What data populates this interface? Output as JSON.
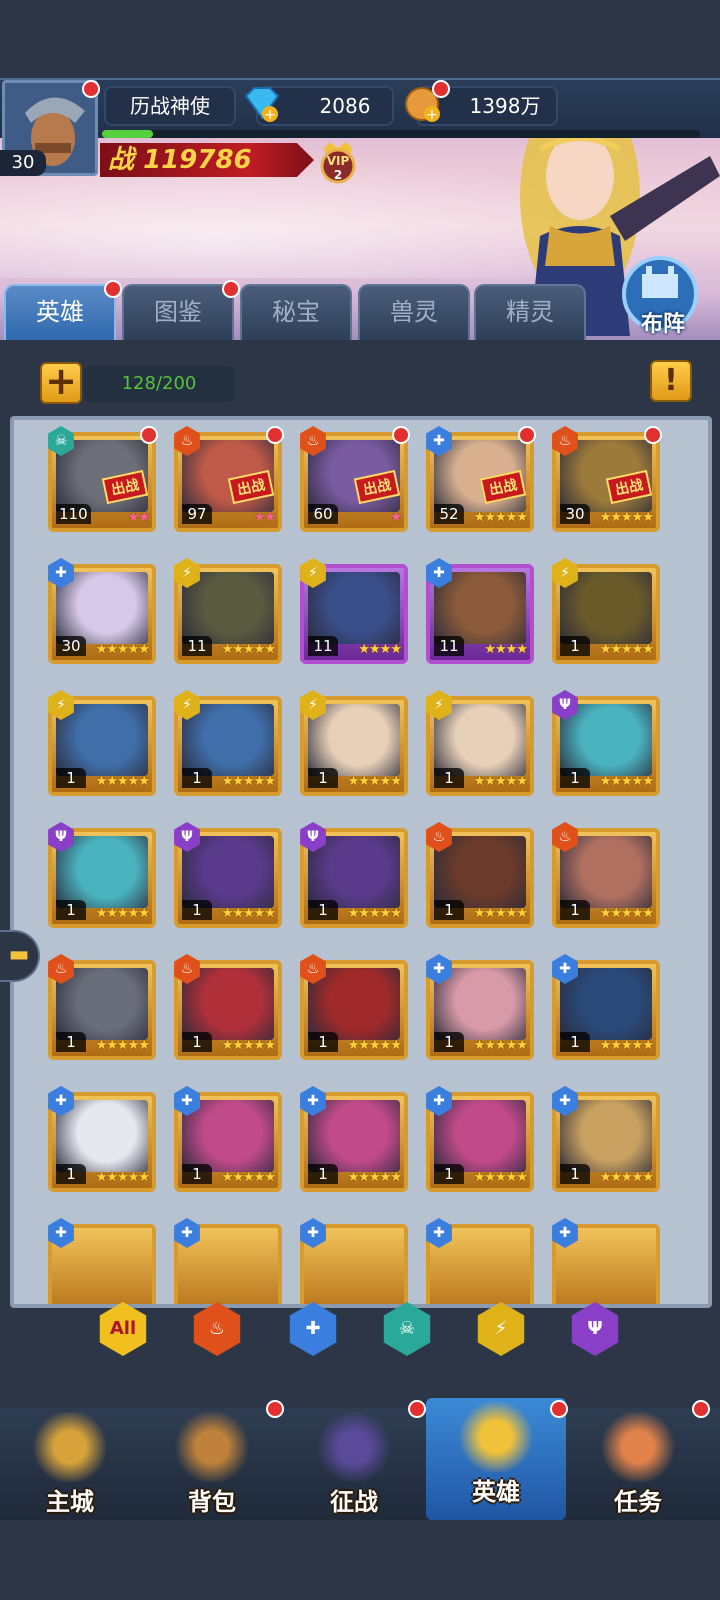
{
  "player": {
    "level": "30",
    "title": "历战神使",
    "diamonds": "2086",
    "gold": "1398万",
    "power_label": "战",
    "power_value": "119786",
    "vip_label": "VIP",
    "vip_level": "2",
    "exp_progress": 0.085
  },
  "tabs": [
    {
      "label": "英雄",
      "active": true,
      "dot": true
    },
    {
      "label": "图鉴",
      "active": false,
      "dot": true
    },
    {
      "label": "秘宝",
      "active": false,
      "dot": false
    },
    {
      "label": "兽灵",
      "active": false,
      "dot": false
    },
    {
      "label": "精灵",
      "active": false,
      "dot": false
    }
  ],
  "formation_label": "布阵",
  "hero_count": "128/200",
  "deploy_badge": "出战",
  "heroes": [
    {
      "level": "110",
      "stars": 2,
      "star_color": "pink",
      "faction": "skull",
      "deployed": true,
      "dot": true
    },
    {
      "level": "97",
      "stars": 2,
      "star_color": "pink",
      "faction": "fire",
      "deployed": true,
      "dot": true
    },
    {
      "level": "60",
      "stars": 1,
      "star_color": "pink",
      "faction": "fire",
      "deployed": true,
      "dot": true
    },
    {
      "level": "52",
      "stars": 5,
      "star_color": "gold",
      "faction": "cross",
      "deployed": true,
      "dot": true
    },
    {
      "level": "30",
      "stars": 5,
      "star_color": "gold",
      "faction": "fire",
      "deployed": true,
      "dot": true
    },
    {
      "level": "30",
      "stars": 5,
      "star_color": "gold",
      "faction": "cross",
      "deployed": false,
      "dot": false
    },
    {
      "level": "11",
      "stars": 5,
      "star_color": "gold",
      "faction": "wing",
      "deployed": false,
      "dot": false
    },
    {
      "level": "11",
      "stars": 4,
      "star_color": "gold",
      "faction": "wing",
      "deployed": false,
      "dot": false,
      "rarity": "purple"
    },
    {
      "level": "11",
      "stars": 4,
      "star_color": "gold",
      "faction": "cross",
      "deployed": false,
      "dot": false,
      "rarity": "purple"
    },
    {
      "level": "1",
      "stars": 5,
      "star_color": "gold",
      "faction": "wing",
      "deployed": false,
      "dot": false
    },
    {
      "level": "1",
      "stars": 5,
      "star_color": "gold",
      "faction": "wing",
      "deployed": false,
      "dot": false
    },
    {
      "level": "1",
      "stars": 5,
      "star_color": "gold",
      "faction": "wing",
      "deployed": false,
      "dot": false
    },
    {
      "level": "1",
      "stars": 5,
      "star_color": "gold",
      "faction": "wing",
      "deployed": false,
      "dot": false
    },
    {
      "level": "1",
      "stars": 5,
      "star_color": "gold",
      "faction": "wing",
      "deployed": false,
      "dot": false
    },
    {
      "level": "1",
      "stars": 5,
      "star_color": "gold",
      "faction": "trident",
      "deployed": false,
      "dot": false
    },
    {
      "level": "1",
      "stars": 5,
      "star_color": "gold",
      "faction": "trident",
      "deployed": false,
      "dot": false
    },
    {
      "level": "1",
      "stars": 5,
      "star_color": "gold",
      "faction": "trident",
      "deployed": false,
      "dot": false
    },
    {
      "level": "1",
      "stars": 5,
      "star_color": "gold",
      "faction": "trident",
      "deployed": false,
      "dot": false
    },
    {
      "level": "1",
      "stars": 5,
      "star_color": "gold",
      "faction": "fire",
      "deployed": false,
      "dot": false
    },
    {
      "level": "1",
      "stars": 5,
      "star_color": "gold",
      "faction": "fire",
      "deployed": false,
      "dot": false
    },
    {
      "level": "1",
      "stars": 5,
      "star_color": "gold",
      "faction": "fire",
      "deployed": false,
      "dot": false
    },
    {
      "level": "1",
      "stars": 5,
      "star_color": "gold",
      "faction": "fire",
      "deployed": false,
      "dot": false
    },
    {
      "level": "1",
      "stars": 5,
      "star_color": "gold",
      "faction": "fire",
      "deployed": false,
      "dot": false
    },
    {
      "level": "1",
      "stars": 5,
      "star_color": "gold",
      "faction": "cross",
      "deployed": false,
      "dot": false
    },
    {
      "level": "1",
      "stars": 5,
      "star_color": "gold",
      "faction": "cross",
      "deployed": false,
      "dot": false
    },
    {
      "level": "1",
      "stars": 5,
      "star_color": "gold",
      "faction": "cross",
      "deployed": false,
      "dot": false
    },
    {
      "level": "1",
      "stars": 5,
      "star_color": "gold",
      "faction": "cross",
      "deployed": false,
      "dot": false
    },
    {
      "level": "1",
      "stars": 5,
      "star_color": "gold",
      "faction": "cross",
      "deployed": false,
      "dot": false
    },
    {
      "level": "1",
      "stars": 5,
      "star_color": "gold",
      "faction": "cross",
      "deployed": false,
      "dot": false
    },
    {
      "level": "1",
      "stars": 5,
      "star_color": "gold",
      "faction": "cross",
      "deployed": false,
      "dot": false
    }
  ],
  "partial_row_factions": [
    "cross",
    "cross",
    "cross",
    "cross",
    "cross"
  ],
  "filters": [
    {
      "label": "All",
      "icon": "all-icon",
      "color": "#f2c01e"
    },
    {
      "label": "",
      "icon": "fire-icon",
      "color": "#e0501a"
    },
    {
      "label": "",
      "icon": "cross-icon",
      "color": "#3a7ee0"
    },
    {
      "label": "",
      "icon": "skull-icon",
      "color": "#2aa89a"
    },
    {
      "label": "",
      "icon": "wing-icon",
      "color": "#e0b21a"
    },
    {
      "label": "",
      "icon": "trident-icon",
      "color": "#8a3fc9"
    }
  ],
  "nav": [
    {
      "label": "主城",
      "icon": "castle-icon",
      "active": false,
      "dot": false
    },
    {
      "label": "背包",
      "icon": "chest-icon",
      "active": false,
      "dot": true
    },
    {
      "label": "征战",
      "icon": "portal-icon",
      "active": false,
      "dot": true
    },
    {
      "label": "英雄",
      "icon": "helmet-icon",
      "active": true,
      "dot": true
    },
    {
      "label": "任务",
      "icon": "scroll-icon",
      "active": false,
      "dot": true
    }
  ],
  "colors": {
    "accent": "#2e6aad",
    "gold": "#ffd23b",
    "power_red": "#c01c24",
    "count_green": "#55c23a",
    "notify_red": "#e23030"
  }
}
